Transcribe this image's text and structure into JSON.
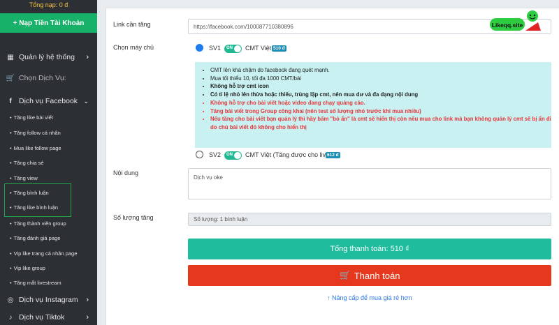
{
  "sidebar": {
    "topup_total": "Tổng nạp: 0 đ",
    "topup_button": "+ Nạp Tiền Tài Khoản",
    "system_label": "Quản lý hệ thống",
    "choose_service": "Chọn Dịch Vụ:",
    "facebook_label": "Dịch vụ Facebook",
    "facebook_items": [
      "Tăng like bài viết",
      "Tăng follow cá nhân",
      "Mua like follow page",
      "Tăng chia sẻ",
      "Tăng view",
      "Tăng bình luận",
      "Tăng like bình luận",
      "Tăng thành viên group",
      "Tăng đánh giá page",
      "Vip like trang cá nhân page",
      "Vip like group",
      "Tăng mắt livestream"
    ],
    "instagram_label": "Dịch vụ Instagram",
    "tiktok_label": "Dịch vụ Tiktok"
  },
  "form": {
    "link_label": "Link cần tăng",
    "link_value": "https://facebook.com/100087710380896",
    "server_label": "Chọn máy chủ",
    "sv1": {
      "name": "SV1",
      "toggle": "ON",
      "desc": "CMT Việt",
      "price": "510 đ"
    },
    "sv2": {
      "name": "SV2",
      "toggle": "ON",
      "desc": "CMT Việt (Tăng được cho live)",
      "price": "612 đ"
    },
    "notes": [
      {
        "text": "CMT lên khá chậm do facebook đang quét mạnh.",
        "style": "n"
      },
      {
        "text": "Mua tối thiểu 10, tối đa 1000 CMT/bài",
        "style": "n"
      },
      {
        "text": "Không hỗ trợ cmt icon",
        "style": "b"
      },
      {
        "text": "Có tỉ lệ nhỏ lên thừa hoặc thiếu, trùng lặp cmt, nên mua dư và đa dạng nội dung",
        "style": "b"
      },
      {
        "text": "Không hỗ trợ cho bài viết hoặc video đang chạy quảng cáo.",
        "style": "r"
      },
      {
        "text": "Tăng bài viết trong Group công khai (nên test số lượng nhỏ trước khi mua nhiều)",
        "style": "r"
      },
      {
        "text": "Nếu tăng cho bài viết bạn quản lý thì hãy bấm \"bỏ ẩn\" là cmt sẽ hiển thị còn nếu mua cho link mà bạn không quản lý cmt sẽ bị ẩn đi do chủ bài viết đó không cho hiển thị",
        "style": "r"
      }
    ],
    "content_label": "Nội dung",
    "content_value": "Dịch vụ oke",
    "quantity_label": "Số lượng tăng",
    "quantity_value": "Số lượng: 1 bình luận",
    "total_button": "Tổng thanh toán: 510  ₫",
    "pay_button": "Thanh toán",
    "upgrade_link": "Nâng cấp để mua giá rẻ hơn"
  },
  "logo": {
    "text": "Likeqq.site"
  }
}
